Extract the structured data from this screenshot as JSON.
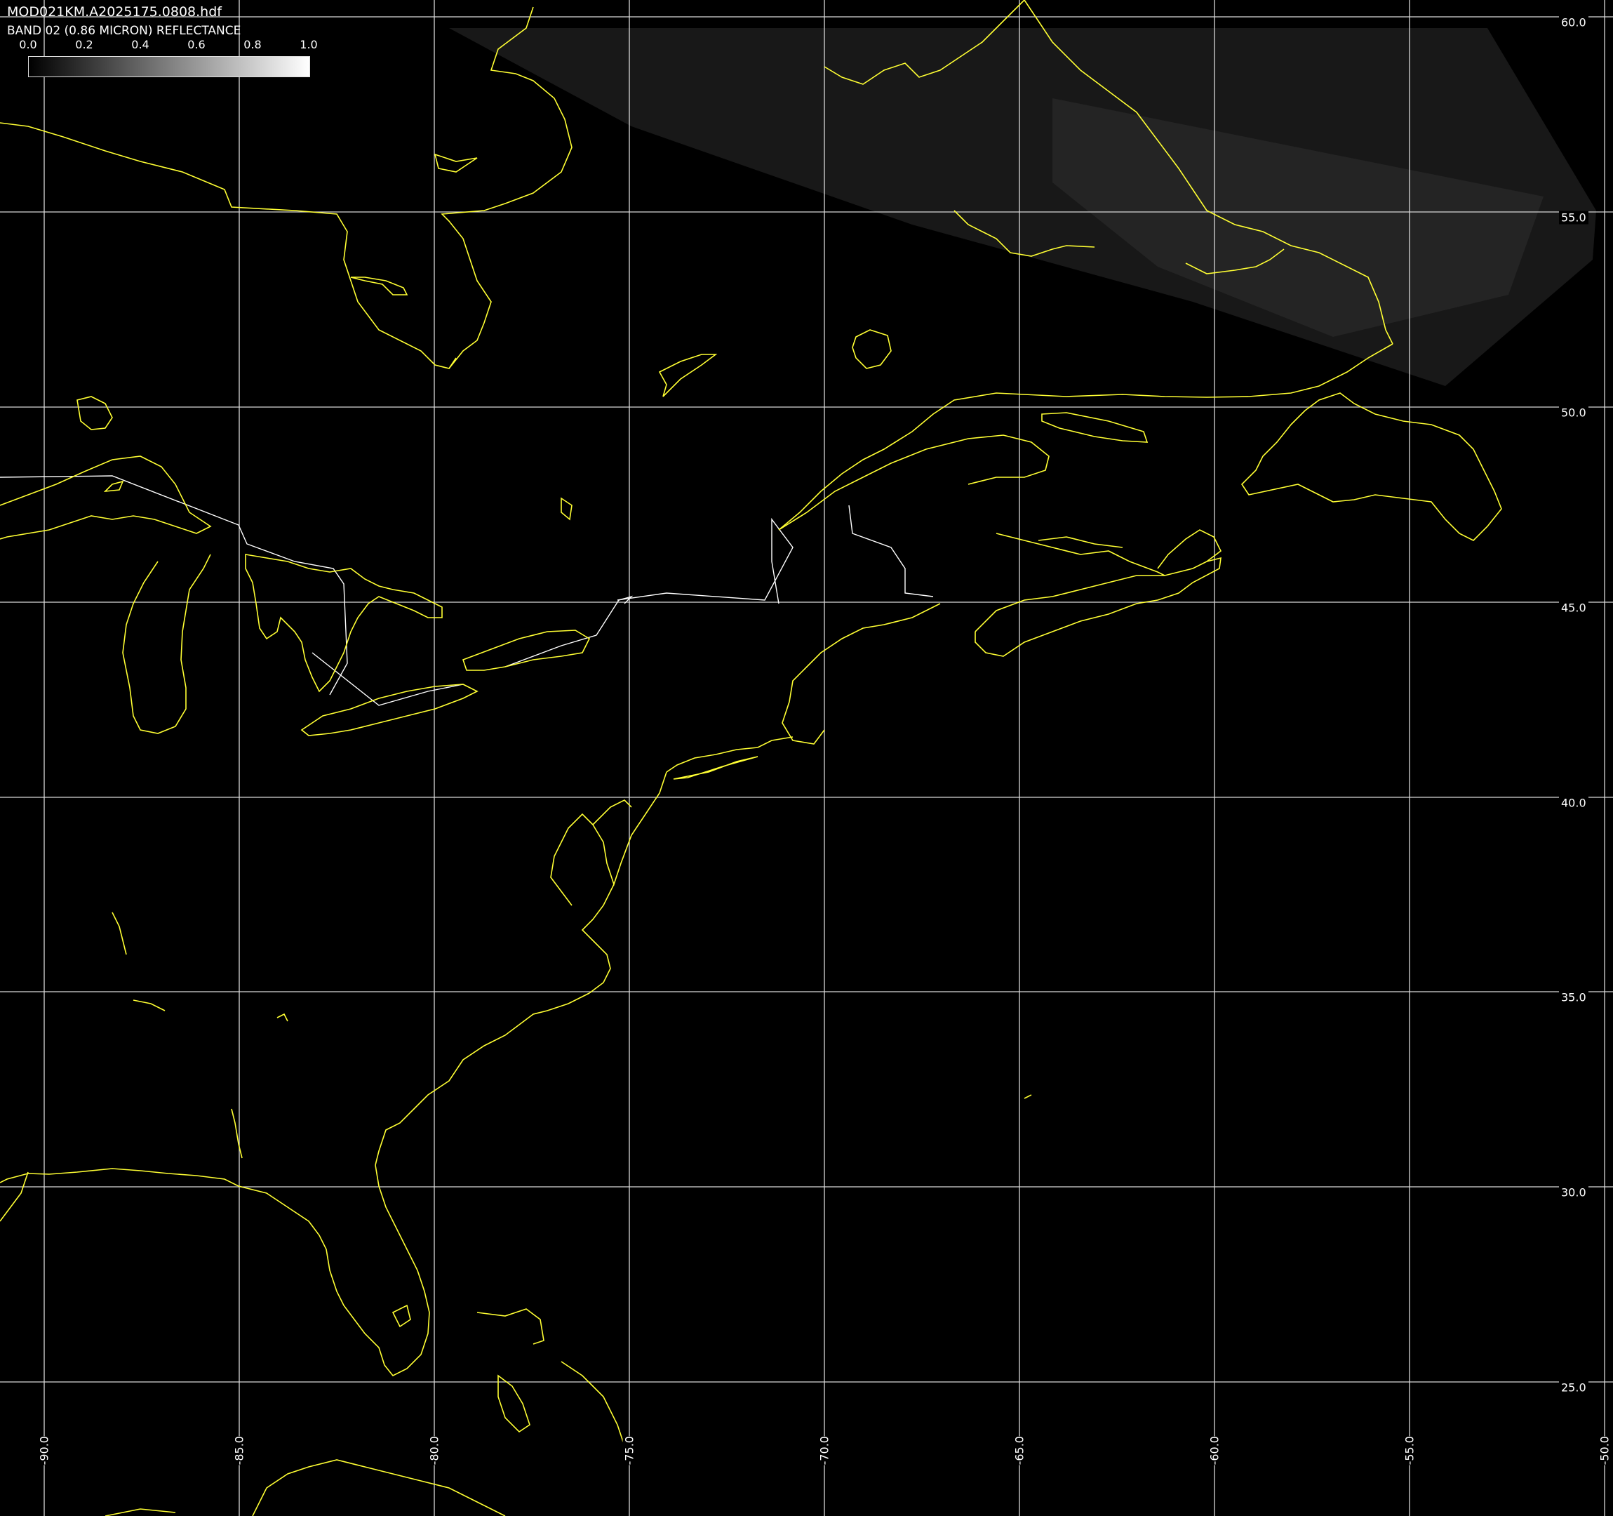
{
  "header": {
    "file_name": "MOD021KM.A2025175.0808.hdf",
    "band_label": "BAND 02 (0.86 MICRON) REFLECTANCE"
  },
  "colorbar": {
    "ticks": [
      "0.0",
      "0.2",
      "0.4",
      "0.6",
      "0.8",
      "1.0"
    ],
    "gradient_start": "#000000",
    "gradient_end": "#ffffff"
  },
  "grid": {
    "lat_labels": [
      "60.0",
      "55.0",
      "50.0",
      "45.0",
      "40.0",
      "35.0",
      "30.0",
      "25.0"
    ],
    "lon_labels": [
      "-90.0",
      "-85.0",
      "-80.0",
      "-75.0",
      "-70.0",
      "-65.0",
      "-60.0",
      "-55.0",
      "-50.0"
    ],
    "line_color": "#d8d8d8"
  },
  "map": {
    "coast_color": "#ffff33",
    "border_color": "#ffffff",
    "background": "#000000"
  }
}
